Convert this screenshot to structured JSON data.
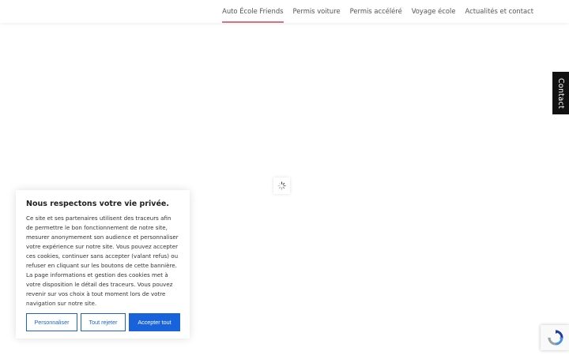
{
  "nav": {
    "items": [
      {
        "label": "Auto École Friends"
      },
      {
        "label": "Permis voiture"
      },
      {
        "label": "Permis accéléré"
      },
      {
        "label": "Voyage école"
      },
      {
        "label": "Actualités et contact"
      }
    ],
    "active_index": 0
  },
  "contact_tab": {
    "label": "Contact"
  },
  "cookie_banner": {
    "title": "Nous respectons votre vie privée.",
    "body": "Ce site et ses partenaires utilisent des traceurs afin de permettre le bon fonctionnement de notre site, mesurer anonymement son audience et personnaliser votre expérience sur notre site. Vous pouvez accepter ces cookies, continuer sans accepter (valant refus) ou refuser en cliquant sur les boutons de cette bannière. La page informations et gestion des cookies met à votre disposition le détail des traceurs. Vous pouvez revenir sur vos choix à tout moment lors de votre navigation sur notre site.",
    "buttons": {
      "customize": "Personnaliser",
      "reject": "Tout rejeter",
      "accept": "Accepter tout"
    }
  },
  "colors": {
    "nav_active_underline": "#d9737e",
    "button_blue": "#1863dc",
    "contact_tab_bg": "#111111"
  },
  "icons": {
    "loader": "loading-spinner-icon",
    "recaptcha": "recaptcha-icon"
  }
}
